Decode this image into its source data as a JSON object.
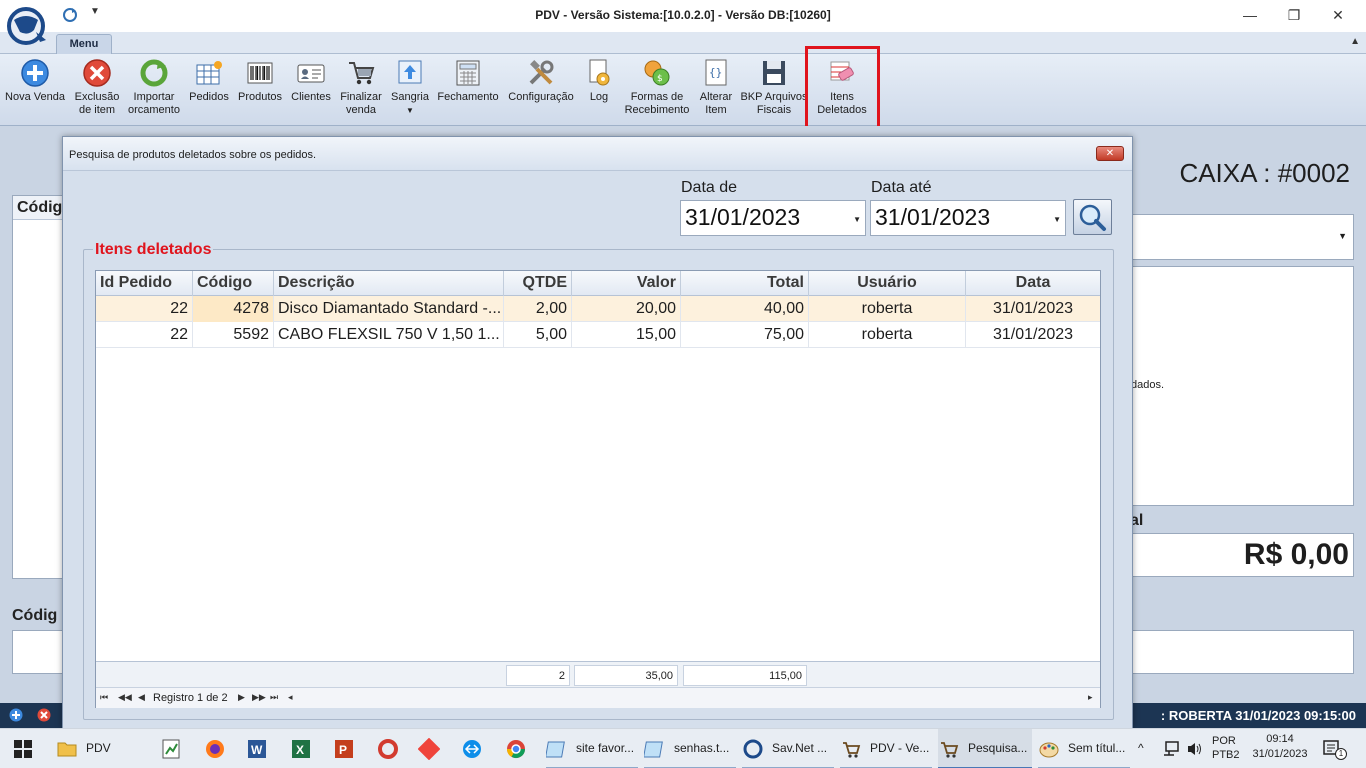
{
  "window": {
    "title": "PDV - Versão Sistema:[10.0.2.0] - Versão DB:[10260]",
    "minimize_glyph": "—",
    "restore_glyph": "❐",
    "close_glyph": "✕"
  },
  "ribbon": {
    "tab": "Menu",
    "buttons": [
      {
        "label": "Nova Venda",
        "icon": "plus-circle-icon"
      },
      {
        "label": "Exclusão de item",
        "icon": "x-circle-icon"
      },
      {
        "label": "Importar orcamento",
        "icon": "refresh-icon"
      },
      {
        "label": "Pedidos",
        "icon": "grid-star-icon"
      },
      {
        "label": "Produtos",
        "icon": "barcode-icon"
      },
      {
        "label": "Clientes",
        "icon": "id-card-icon"
      },
      {
        "label": "Finalizar venda",
        "icon": "cart-icon"
      },
      {
        "label": "Sangria",
        "icon": "upload-icon"
      },
      {
        "label": "Fechamento",
        "icon": "calculator-icon"
      },
      {
        "label": "Configuração",
        "icon": "tools-icon"
      },
      {
        "label": "Log",
        "icon": "doc-gear-icon"
      },
      {
        "label": "Formas de Recebimento",
        "icon": "coins-icon"
      },
      {
        "label": "Alterar Item",
        "icon": "braces-doc-icon"
      },
      {
        "label": "BKP Arquivos Fiscais",
        "icon": "floppy-icon"
      },
      {
        "label": "Itens Deletados",
        "icon": "eraser-icon"
      }
    ]
  },
  "background": {
    "left_label": "Códig",
    "left_label2": "Códig",
    "caixa": "CAIXA : #0002",
    "right_text": "dados.",
    "total_label": "al",
    "total_value": "R$ 0,00",
    "status_text": ": ROBERTA   31/01/2023 09:15:00"
  },
  "dialog": {
    "title": "Pesquisa de produtos deletados sobre os pedidos.",
    "close_label": "✕",
    "date_from_label": "Data de",
    "date_from": "31/01/2023",
    "date_to_label": "Data até",
    "date_to": "31/01/2023",
    "group_title": "Itens deletados",
    "columns": [
      "Id Pedido",
      "Código",
      "Descrição",
      "QTDE",
      "Valor",
      "Total",
      "Usuário",
      "Data"
    ],
    "rows": [
      [
        "22",
        "4278",
        "Disco Diamantado Standard -...",
        "2,00",
        "20,00",
        "40,00",
        "roberta",
        "31/01/2023"
      ],
      [
        "22",
        "5592",
        "CABO FLEXSIL 750 V 1,50 1...",
        "5,00",
        "15,00",
        "75,00",
        "roberta",
        "31/01/2023"
      ]
    ],
    "footer": {
      "qtde": "2",
      "valor": "35,00",
      "total": "115,00"
    },
    "navigator": "Registro 1 de 2"
  },
  "taskbar": {
    "items": [
      {
        "label": "PDV",
        "icon": "folder-icon"
      },
      {
        "label": "",
        "icon": "notepad-chart-icon"
      },
      {
        "label": "",
        "icon": "firefox-icon"
      },
      {
        "label": "",
        "icon": "word-icon"
      },
      {
        "label": "",
        "icon": "excel-icon"
      },
      {
        "label": "",
        "icon": "powerpoint-icon"
      },
      {
        "label": "",
        "icon": "ccleaner-icon"
      },
      {
        "label": "",
        "icon": "anydesk-icon"
      },
      {
        "label": "",
        "icon": "teamviewer-icon"
      },
      {
        "label": "",
        "icon": "chrome-icon"
      },
      {
        "label": "site favor...",
        "icon": "notepad-icon"
      },
      {
        "label": "senhas.t...",
        "icon": "notepad-icon"
      },
      {
        "label": "Sav.Net ...",
        "icon": "savnet-icon"
      },
      {
        "label": "PDV - Ve...",
        "icon": "pdv-cart-icon"
      },
      {
        "label": "Pesquisa...",
        "icon": "pdv-cart-icon"
      },
      {
        "label": "Sem títul...",
        "icon": "paint-icon"
      }
    ],
    "lang_top": "POR",
    "lang_bottom": "PTB2",
    "time": "09:14",
    "date": "31/01/2023",
    "notif_count": "1"
  },
  "colors": {
    "accent_red": "#e0141d",
    "status_bar": "#1c3553"
  }
}
